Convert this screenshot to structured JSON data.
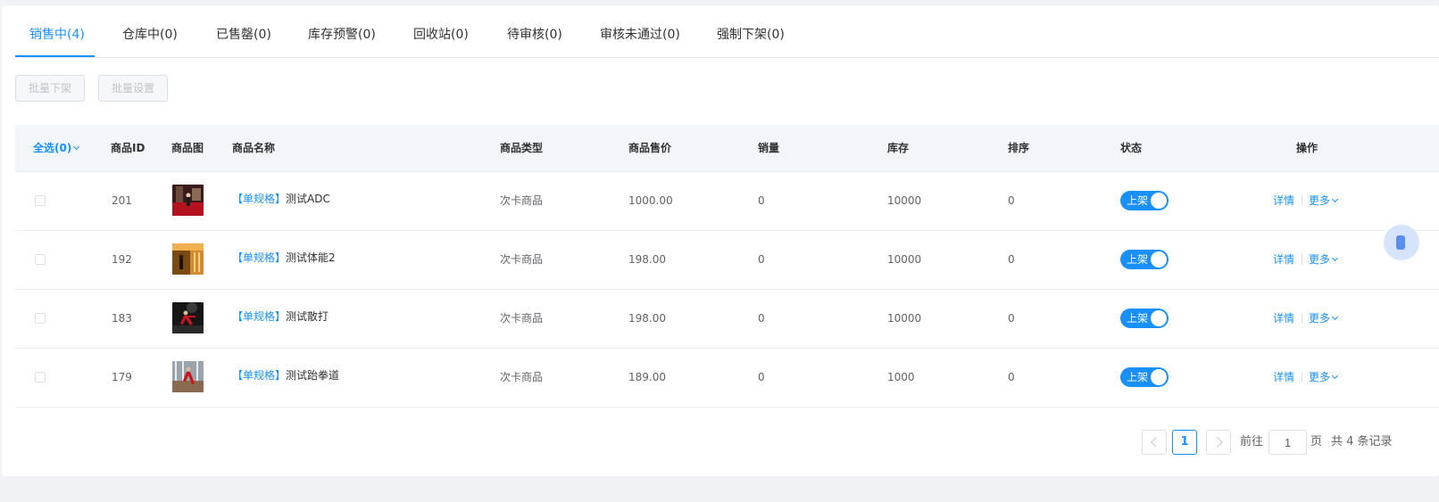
{
  "tabs": [
    {
      "label": "销售中(4)"
    },
    {
      "label": "仓库中(0)"
    },
    {
      "label": "已售罄(0)"
    },
    {
      "label": "库存预警(0)"
    },
    {
      "label": "回收站(0)"
    },
    {
      "label": "待审核(0)"
    },
    {
      "label": "审核未通过(0)"
    },
    {
      "label": "强制下架(0)"
    }
  ],
  "batch": {
    "offline": "批量下架",
    "settings": "批量设置"
  },
  "table": {
    "headers": {
      "select_all": "全选(0)",
      "id": "商品ID",
      "image": "商品图",
      "name": "商品名称",
      "type": "商品类型",
      "price": "商品售价",
      "sales": "销量",
      "stock": "库存",
      "sort": "排序",
      "status": "状态",
      "actions": "操作"
    },
    "rows": [
      {
        "id": "201",
        "tag": "【单规格】",
        "name": "测试ADC",
        "type": "次卡商品",
        "price": "1000.00",
        "sales": "0",
        "stock": "10000",
        "sort": "0",
        "status": "上架",
        "detail": "详情",
        "more": "更多"
      },
      {
        "id": "192",
        "tag": "【单规格】",
        "name": "测试体能2",
        "type": "次卡商品",
        "price": "198.00",
        "sales": "0",
        "stock": "10000",
        "sort": "0",
        "status": "上架",
        "detail": "详情",
        "more": "更多"
      },
      {
        "id": "183",
        "tag": "【单规格】",
        "name": "测试散打",
        "type": "次卡商品",
        "price": "198.00",
        "sales": "0",
        "stock": "10000",
        "sort": "0",
        "status": "上架",
        "detail": "详情",
        "more": "更多"
      },
      {
        "id": "179",
        "tag": "【单规格】",
        "name": "测试跆拳道",
        "type": "次卡商品",
        "price": "189.00",
        "sales": "0",
        "stock": "1000",
        "sort": "0",
        "status": "上架",
        "detail": "详情",
        "more": "更多"
      }
    ]
  },
  "pagination": {
    "current_page": "1",
    "goto_label": "前往",
    "goto_value": "1",
    "page_unit": "页",
    "total_label": "共 4 条记录"
  },
  "colors": {
    "accent": "#1890ff",
    "border": "#ebeef5",
    "header_bg": "#f2f6fb"
  }
}
